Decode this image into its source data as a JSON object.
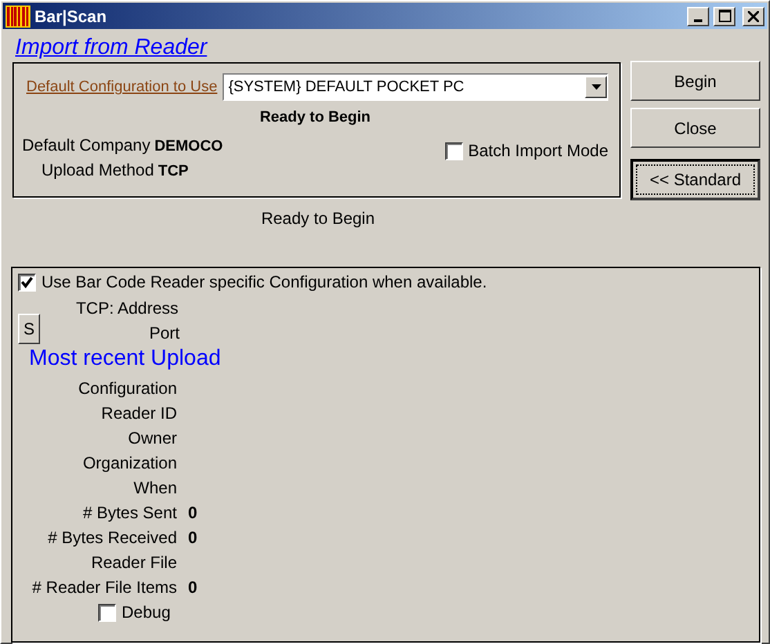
{
  "window": {
    "title": "Bar|Scan"
  },
  "heading": "Import from Reader",
  "import_panel": {
    "config_link": "Default Configuration to Use",
    "config_value": "{SYSTEM} DEFAULT POCKET PC",
    "status": "Ready to Begin",
    "fields": [
      {
        "label": "Default Company",
        "value": "DEMOCO"
      },
      {
        "label": "Upload Method",
        "value": "TCP"
      }
    ],
    "batch_import": {
      "label": "Batch Import Mode",
      "checked": false
    }
  },
  "buttons": [
    {
      "label": "Begin",
      "focused": false
    },
    {
      "label": "Close",
      "focused": false
    },
    {
      "label": "<< Standard",
      "focused": true
    }
  ],
  "status": "Ready to Begin",
  "details": {
    "use_reader_config": {
      "label": "Use Bar Code Reader specific Configuration when available.",
      "checked": true
    },
    "s_button": "S",
    "connection": [
      {
        "label": "TCP: Address"
      },
      {
        "label": "Port"
      }
    ],
    "section_title": "Most recent Upload",
    "rows": [
      {
        "label": "Configuration"
      },
      {
        "label": "Reader ID"
      },
      {
        "label": "Owner"
      },
      {
        "label": "Organization"
      },
      {
        "label": "When"
      },
      {
        "label": "# Bytes Sent",
        "value": "0"
      },
      {
        "label": "# Bytes Received",
        "value": "0"
      },
      {
        "label": "Reader File"
      },
      {
        "label": "# Reader File Items",
        "value": "0"
      }
    ],
    "debug": {
      "label": "Debug",
      "checked": false
    }
  }
}
